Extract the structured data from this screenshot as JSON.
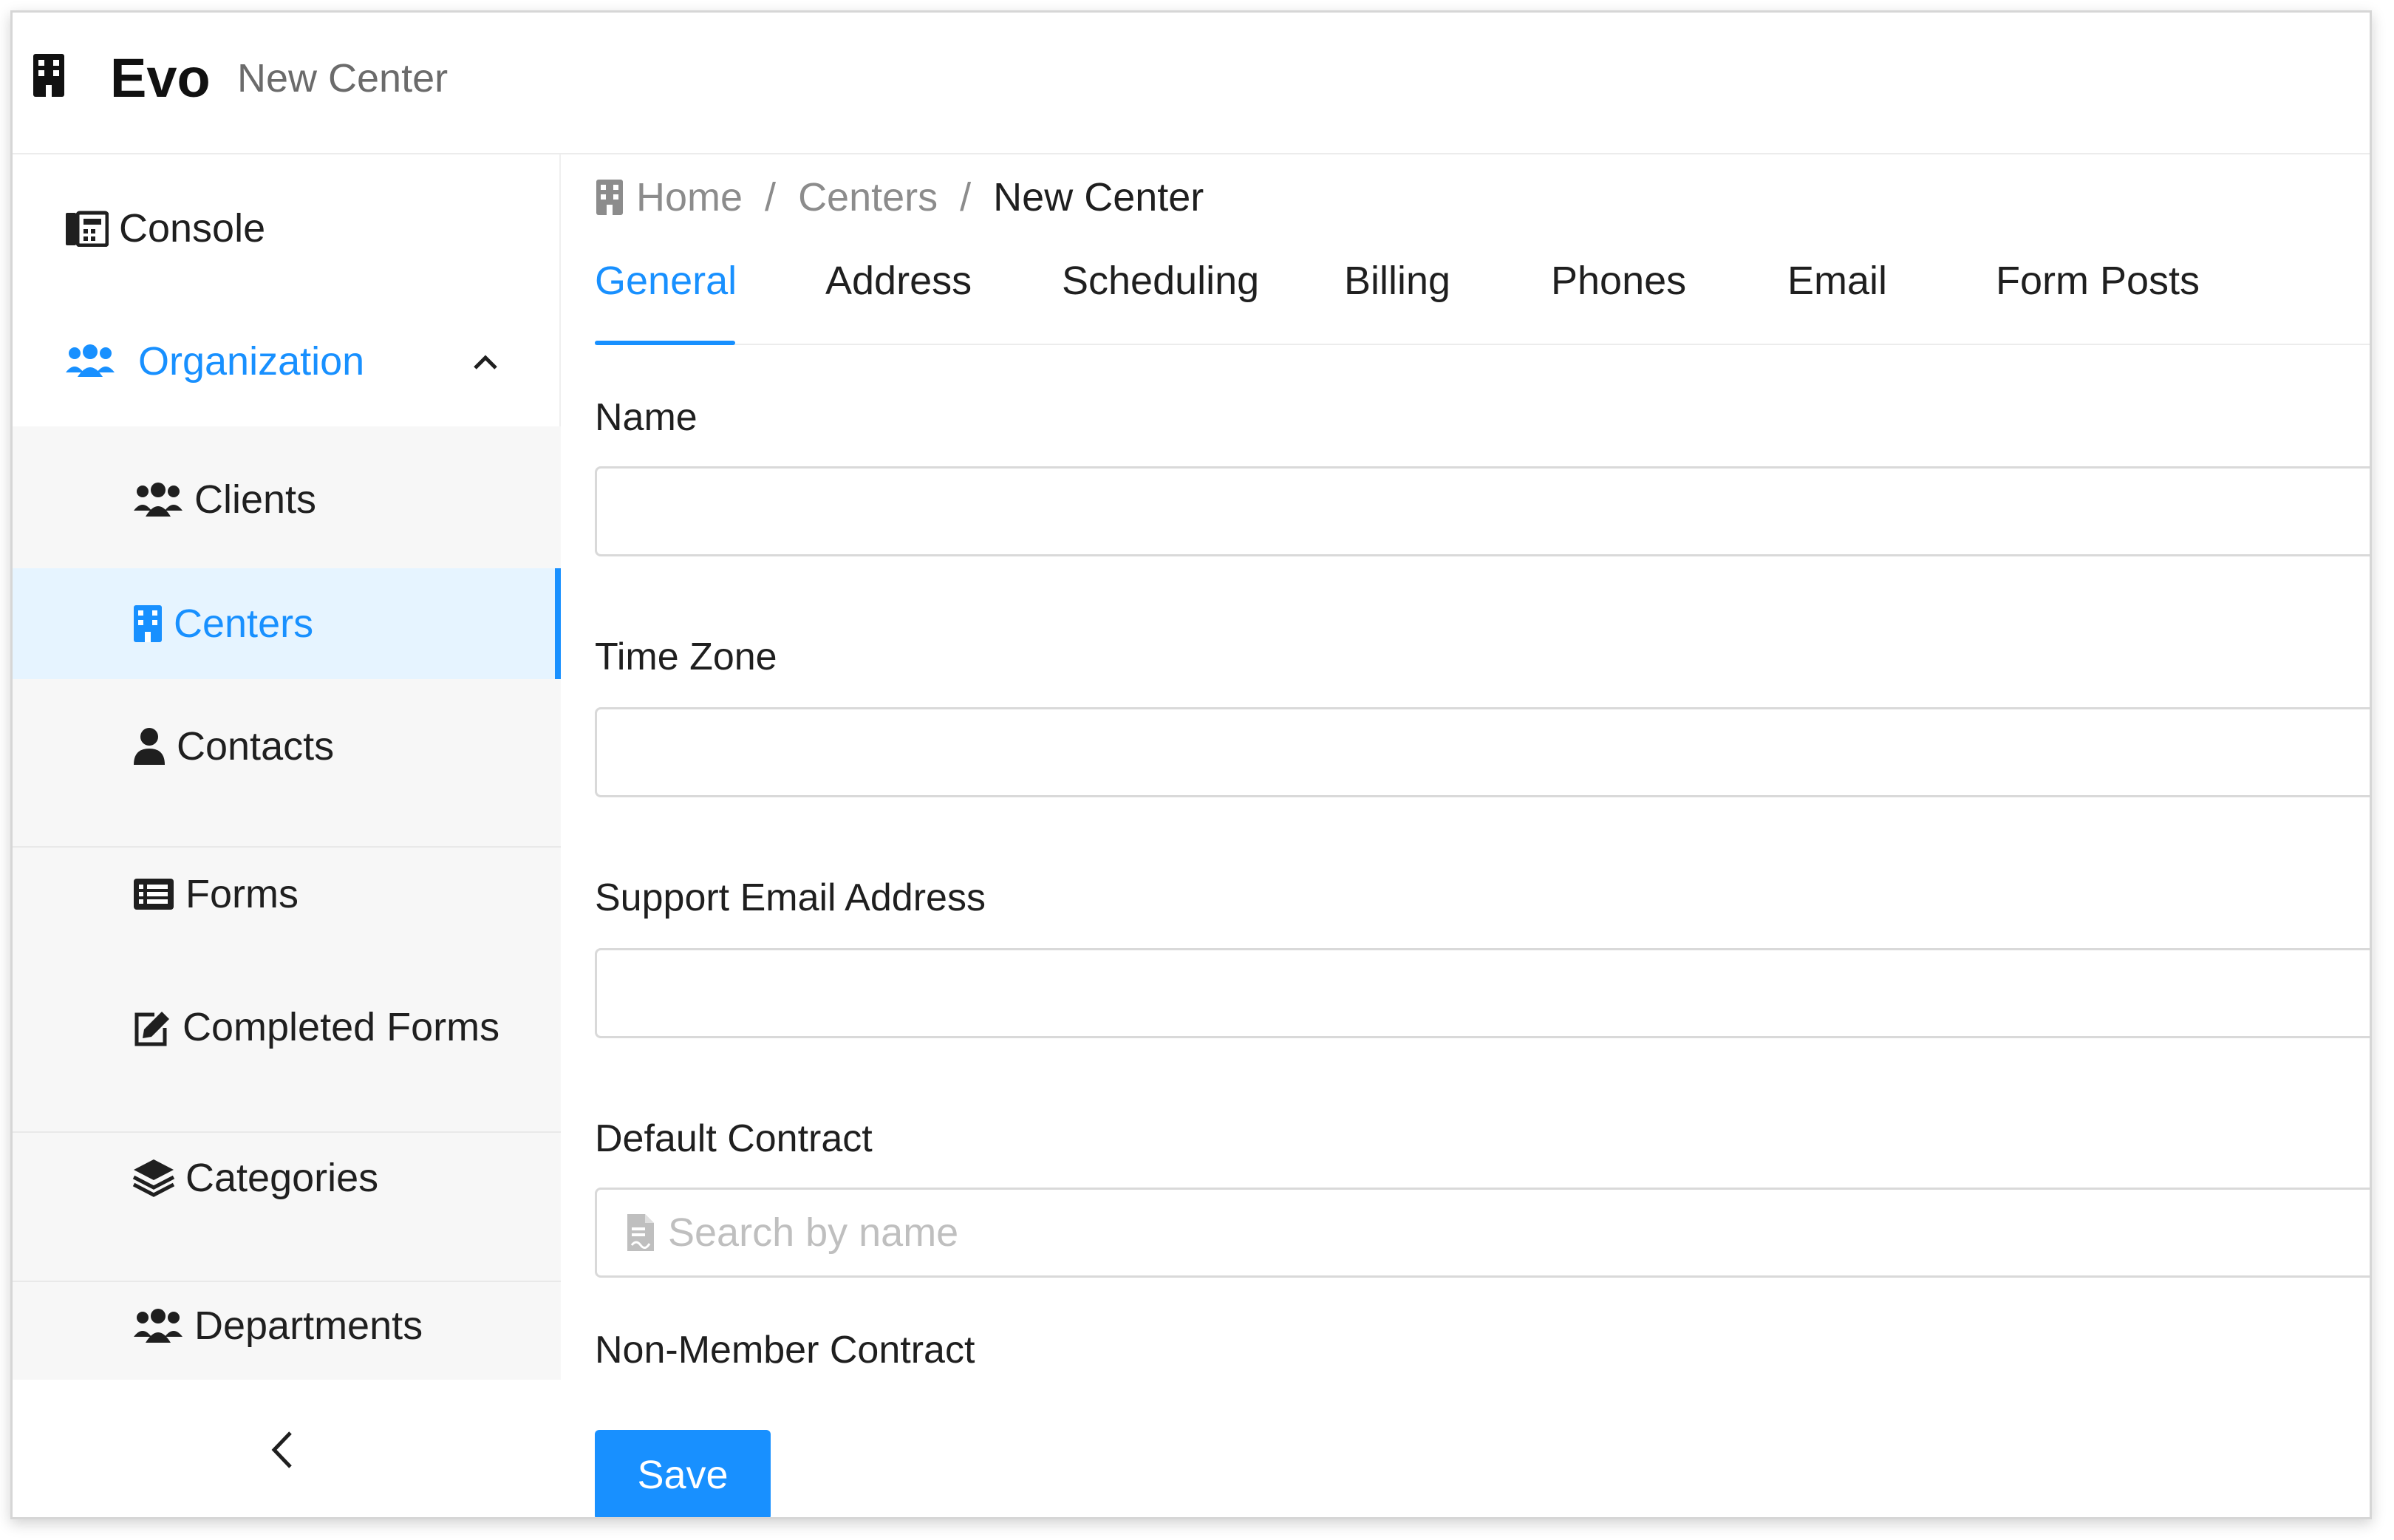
{
  "app": {
    "title": "Evo",
    "subtitle": "New Center"
  },
  "sidebar": {
    "console": "Console",
    "organization": "Organization",
    "items": [
      {
        "label": "Clients",
        "icon": "users-icon"
      },
      {
        "label": "Centers",
        "icon": "building-icon",
        "active": true
      },
      {
        "label": "Contacts",
        "icon": "user-icon"
      },
      {
        "label": "Forms",
        "icon": "list-icon"
      },
      {
        "label": "Completed Forms",
        "icon": "edit-icon"
      },
      {
        "label": "Categories",
        "icon": "layers-icon"
      },
      {
        "label": "Departments",
        "icon": "users-cog-icon"
      }
    ]
  },
  "breadcrumb": {
    "home": "Home",
    "centers": "Centers",
    "current": "New Center"
  },
  "tabs": [
    "General",
    "Address",
    "Scheduling",
    "Billing",
    "Phones",
    "Email",
    "Form Posts"
  ],
  "form": {
    "name_label": "Name",
    "name_value": "",
    "timezone_label": "Time Zone",
    "timezone_value": "",
    "support_email_label": "Support Email Address",
    "support_email_value": "",
    "default_contract_label": "Default Contract",
    "default_contract_placeholder": "Search by name",
    "non_member_contract_label": "Non-Member Contract"
  },
  "actions": {
    "save": "Save"
  },
  "colors": {
    "accent": "#1890ff",
    "active_bg": "#e6f4ff"
  }
}
